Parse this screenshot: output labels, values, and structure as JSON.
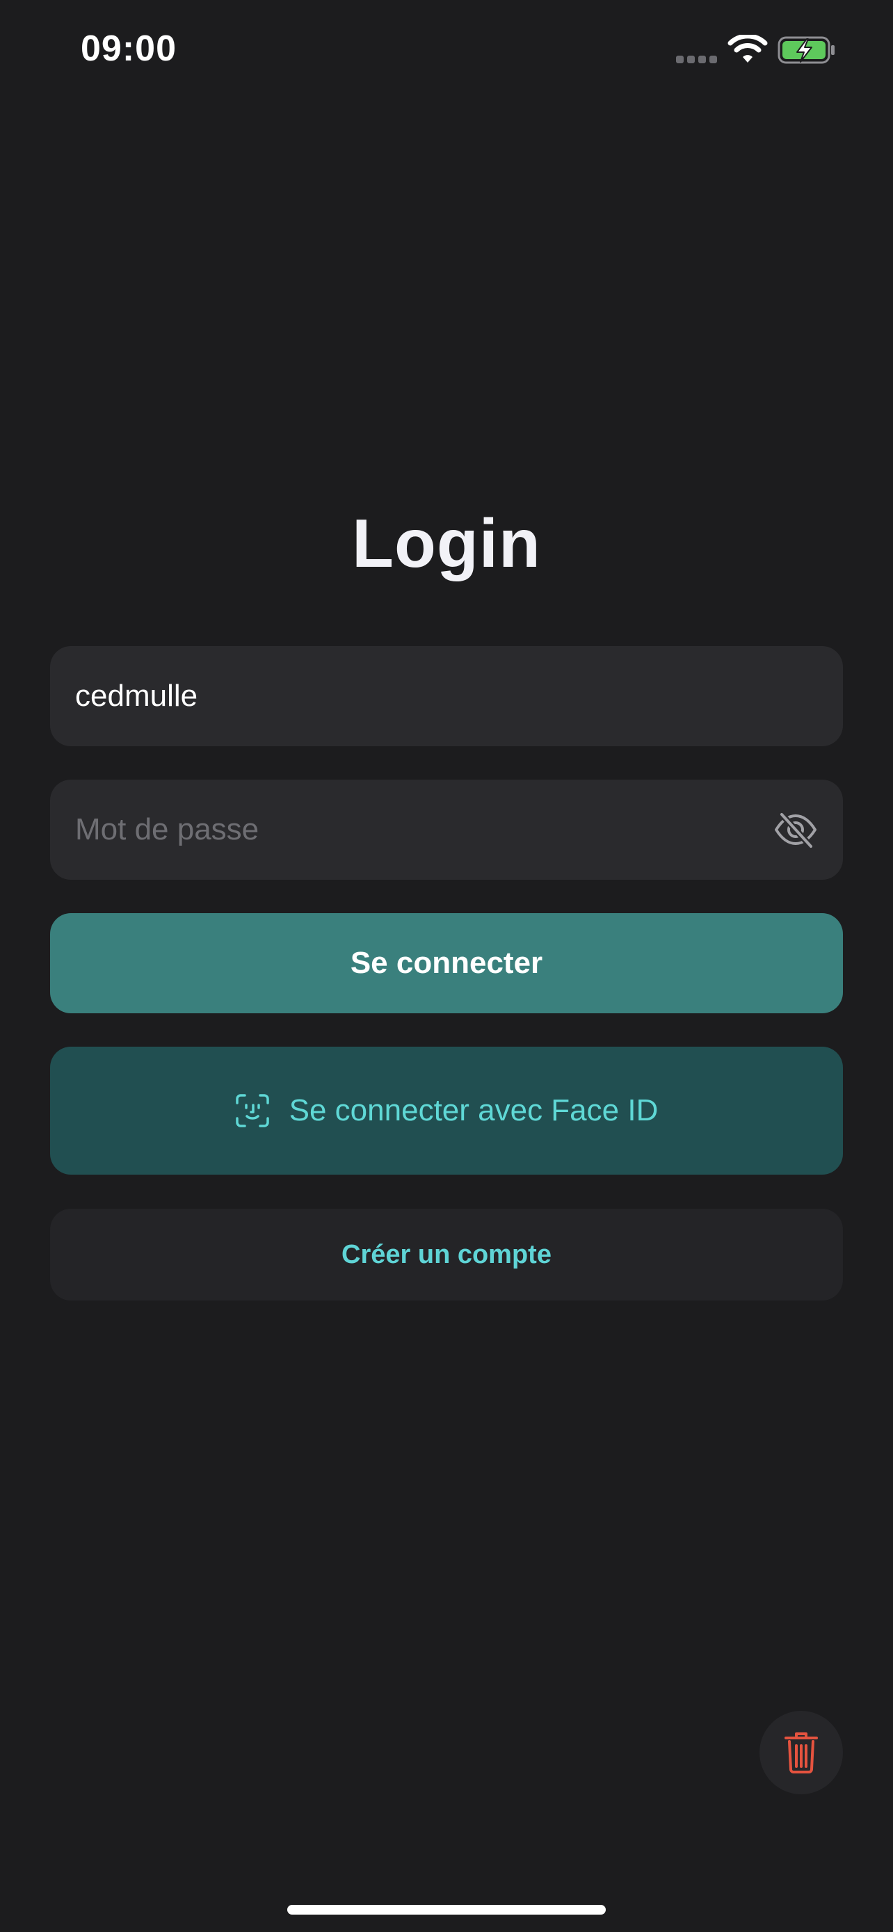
{
  "status_bar": {
    "time": "09:00",
    "icons": [
      "cellular-signal-icon",
      "wifi-icon",
      "battery-charging-icon"
    ]
  },
  "title": "Login",
  "username_field": {
    "value": "cedmulle",
    "placeholder": ""
  },
  "password_field": {
    "value": "",
    "placeholder": "Mot de passe",
    "toggle_icon": "eye-slash-icon"
  },
  "buttons": {
    "login_label": "Se connecter",
    "faceid_label": "Se connecter avec Face ID",
    "faceid_icon": "face-id-icon",
    "create_account_label": "Créer un compte",
    "delete_icon": "trash-icon"
  },
  "colors": {
    "background": "#1c1c1e",
    "field_background": "#2a2a2d",
    "primary_button": "#3a807d",
    "faceid_button": "#214f51",
    "accent_text": "#5fd8d6",
    "destructive": "#e5533f",
    "battery_fill": "#5ec95c"
  }
}
